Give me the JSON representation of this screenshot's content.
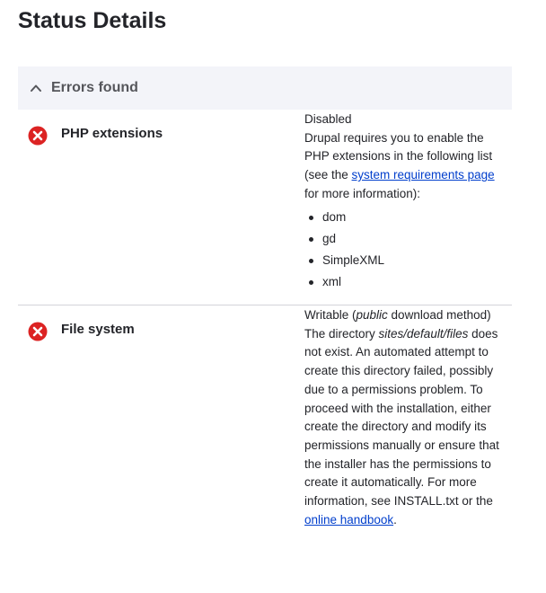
{
  "page": {
    "title": "Status Details"
  },
  "errors_section": {
    "label": "Errors found",
    "toggle_icon": "chevron-up-icon",
    "error_color": "#dc2323",
    "link_color": "#003ecc",
    "header_bg": "#f3f4f9"
  },
  "requirements": [
    {
      "title": "PHP extensions",
      "icon": "error-icon",
      "value": "Disabled",
      "desc_before_link": "Drupal requires you to enable the PHP extensions in the following list (see the ",
      "link_text": "system requirements page",
      "desc_after_link": " for more information):",
      "items": [
        "dom",
        "gd",
        "SimpleXML",
        "xml"
      ]
    },
    {
      "title": "File system",
      "icon": "error-icon",
      "value_prefix": "Writable (",
      "value_emphasis": "public",
      "value_suffix": " download method)",
      "desc_1": "The directory ",
      "desc_path": "sites/default/files",
      "desc_2": " does not exist. An automated attempt to create this directory failed, possibly due to a permissions problem. To proceed with the installation, either create the directory and modify its permissions manually or ensure that the installer has the permissions to create it automatically. For more information, see INSTALL.txt or the ",
      "link_text": "online handbook",
      "desc_end": "."
    }
  ]
}
